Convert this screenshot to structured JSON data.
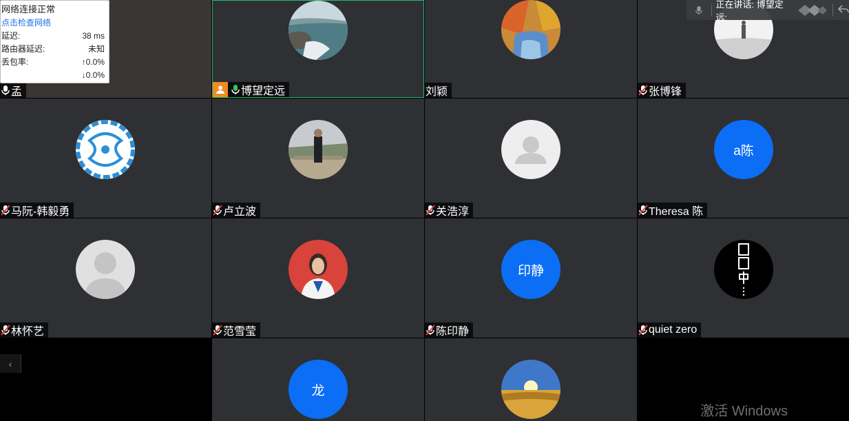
{
  "network_popup": {
    "title": "网络连接正常",
    "link": "点击检查网络",
    "latency_label": "延迟:",
    "latency_value": "38 ms",
    "router_label": "路由器延迟:",
    "router_value": "未知",
    "loss_label": "丢包率:",
    "loss_up": "↑0.0%",
    "loss_down": "↓0.0%"
  },
  "speaking_bar": {
    "text": "正在讲话: 博望定远;"
  },
  "participants": [
    {
      "name": "孟",
      "mic": "on"
    },
    {
      "name": "博望定远",
      "mic": "on",
      "host": true,
      "active": true
    },
    {
      "name": "刘颖",
      "mic": "none"
    },
    {
      "name": "张博锋",
      "mic": "muted"
    },
    {
      "name": "马阮-韩毅勇",
      "mic": "muted"
    },
    {
      "name": "卢立波",
      "mic": "muted"
    },
    {
      "name": "关浩淳",
      "mic": "muted"
    },
    {
      "name": "Theresa 陈",
      "mic": "muted",
      "avatar_text": "a陈"
    },
    {
      "name": "林怀艺",
      "mic": "muted"
    },
    {
      "name": "范雪莹",
      "mic": "muted"
    },
    {
      "name": "陈印静",
      "mic": "muted",
      "avatar_text": "印静"
    },
    {
      "name": "quiet zero",
      "mic": "muted"
    },
    {
      "avatar_text": "龙"
    }
  ],
  "colors": {
    "tile_bg": "#2e3034",
    "avatar_blue": "#0b6ef5",
    "active_border": "#1fbf6a",
    "host_badge": "#f28a21"
  },
  "watermark": "激活 Windows",
  "collapse_icon": "chevron-left-icon"
}
